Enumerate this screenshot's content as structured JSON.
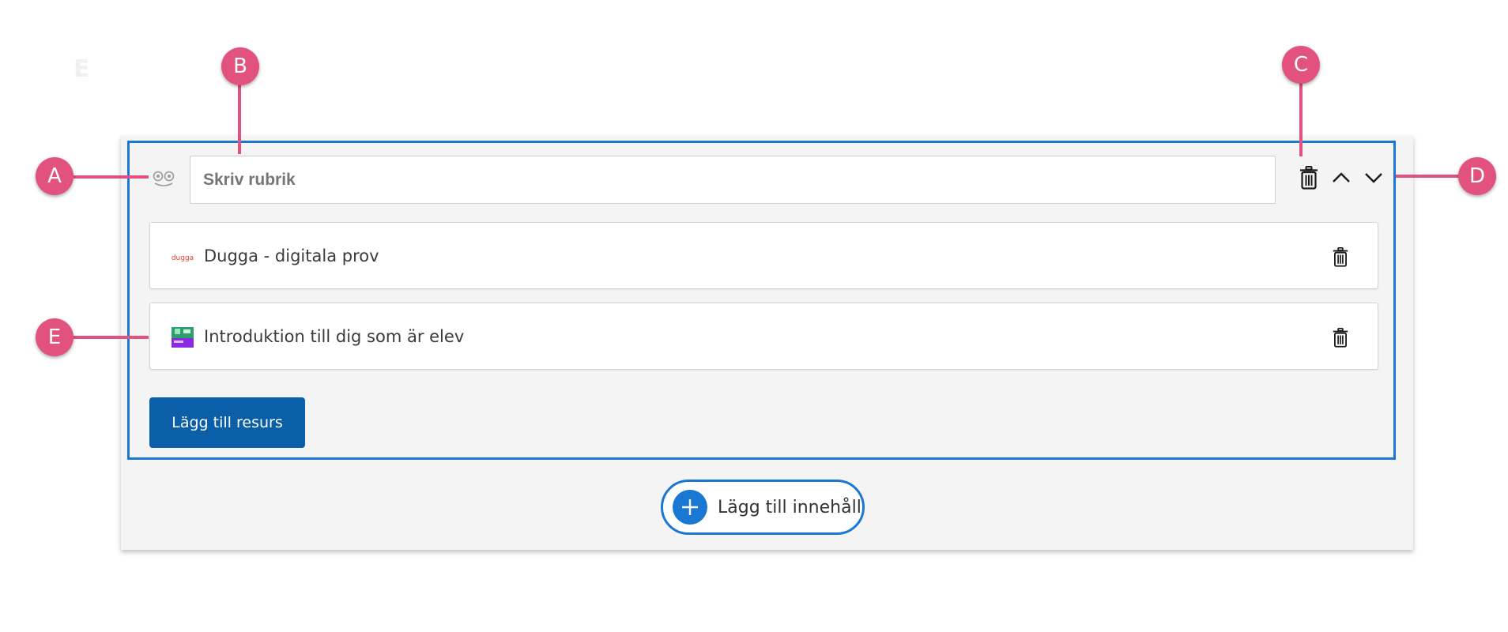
{
  "ghost_marker": "E",
  "section": {
    "heading_placeholder": "Skriv rubrik",
    "heading_value": ""
  },
  "resources": [
    {
      "label": "Dugga - digitala prov",
      "icon": "dugga-logo-icon",
      "logo_text": "dugga"
    },
    {
      "label": "Introduktion till dig som är elev",
      "icon": "course-thumbnail-icon"
    }
  ],
  "add_resource_label": "Lägg till resurs",
  "add_content_label": "Lägg till innehåll",
  "callouts": [
    "A",
    "B",
    "C",
    "D",
    "E"
  ],
  "colors": {
    "accent": "#1a77d2",
    "button_primary": "#0a5fa8",
    "callout": "#e1527f",
    "panel_bg": "#f4f4f4",
    "dugga_logo": "#e0442e",
    "thumbnail_purple": "#8a2be2",
    "thumbnail_green": "#2f9e6e"
  }
}
